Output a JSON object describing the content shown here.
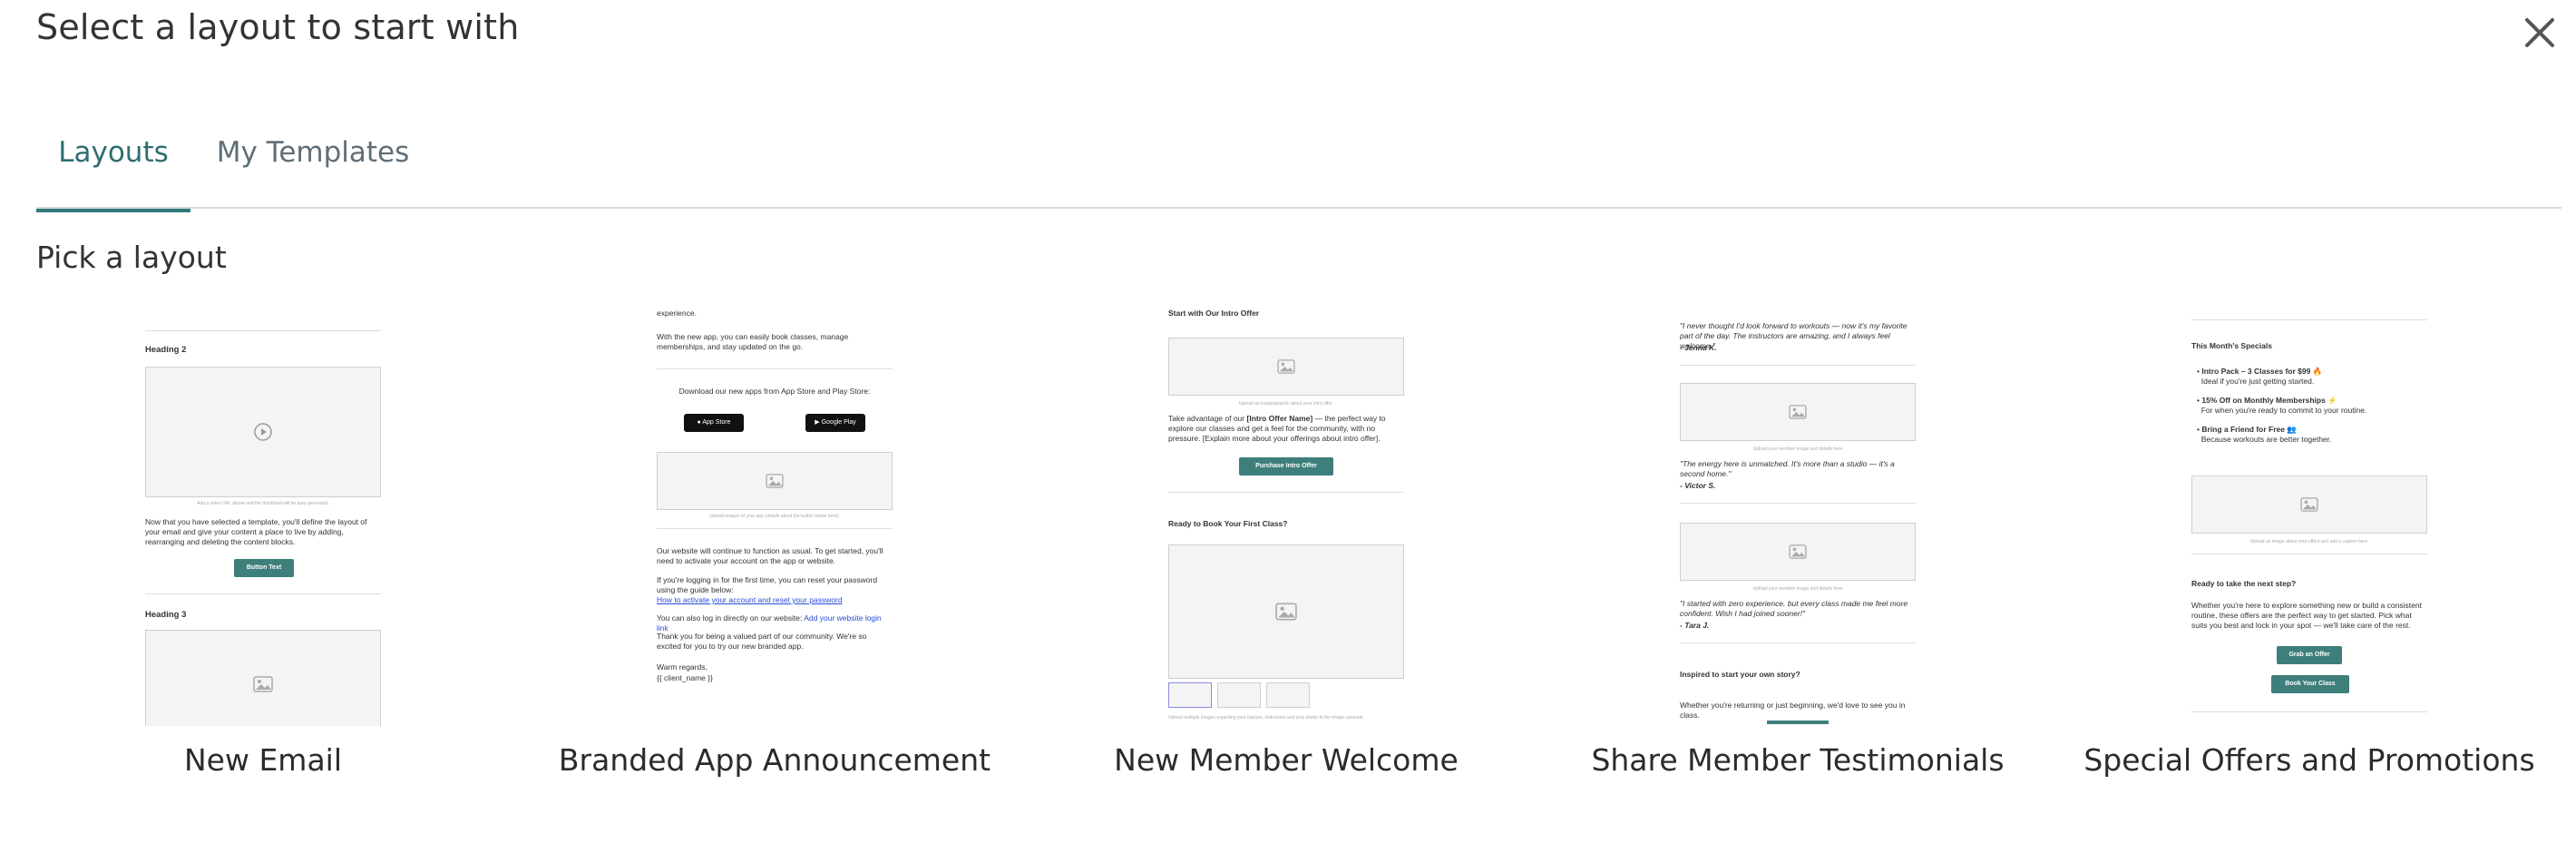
{
  "dialog": {
    "title": "Select a layout to start with",
    "close_icon": "close-icon"
  },
  "tabs": [
    {
      "label": "Layouts",
      "active": true
    },
    {
      "label": "My Templates",
      "active": false
    }
  ],
  "section_title": "Pick a layout",
  "accent_color": "#2f7a7b",
  "layouts": [
    {
      "label": "New Email",
      "preview": {
        "heading2": "Heading 2",
        "video_caption": "Add a video URL above and the thumbnail will be auto-generated.",
        "body": "Now that you have selected a template, you'll define the layout of your email and give your content a place to live by adding, rearranging and deleting the content blocks.",
        "button": "Button Text",
        "heading3": "Heading 3"
      }
    },
    {
      "label": "Branded App Announcement",
      "preview": {
        "top_line": "experience.",
        "intro": "With the new app, you can easily book classes, manage memberships, and stay updated on the go.",
        "download": "Download our new apps from App Store and Play Store:",
        "app_store": "App Store",
        "google_play": "Google Play",
        "image_caption": "Upload images of your app (details about the button below here).",
        "website": "Our website will continue to function as usual. To get started, you'll need to activate your account on the app or website.",
        "reset": "If you're logging in for the first time, you can reset your password using the guide below:",
        "reset_link": "How to activate your account and reset your password",
        "login_prefix": "You can also log in directly on our website:",
        "login_link": "Add your website login link",
        "thanks": "Thank you for being a valued part of our community. We're so excited for you to try our new branded app.",
        "regards": "Warm regards,",
        "client_name": "{{ client_name }}"
      }
    },
    {
      "label": "New Member Welcome",
      "preview": {
        "top_heading": "Start with Our Intro Offer",
        "image_caption": "Upload an image/graphic about your intro offer.",
        "offer_prefix": "Take advantage of our",
        "offer_name": "[Intro Offer Name]",
        "offer_suffix": "— the perfect way to explore our classes and get a feel for the community, with no pressure. [Explain more about your offerings about intro offer].",
        "offer_button": "Purchase Intro Offer",
        "book_heading": "Ready to Book Your First Class?",
        "gallery_caption": "Upload multiple images regarding your classes, instructors and your studio to the image carousel."
      }
    },
    {
      "label": "Share Member Testimonials",
      "preview": {
        "quote1": "\"I never thought I'd look forward to workouts — now it's my favorite part of the day. The instructors are amazing, and I always feel welcome.\"",
        "author1": "- Jenna K.",
        "caption1": "Upload your member image and details here",
        "quote2": "\"The energy here is unmatched. It's more than a studio — it's a second home.\"",
        "author2": "- Victor S.",
        "caption2": "Upload your member image and details here",
        "quote3": "\"I started with zero experience, but every class made me feel more confident. Wish I had joined sooner!\"",
        "author3": "- Tara J.",
        "heading": "Inspired to start your own story?",
        "body": "Whether you're returning or just beginning, we'd love to see you in class."
      }
    },
    {
      "label": "Special Offers and Promotions",
      "preview": {
        "heading": "This Month's Specials",
        "item1_title": "Intro Pack – 3 Classes for $99 🔥",
        "item1_desc": "Ideal if you're just getting started.",
        "item2_title": "15% Off on Monthly Memberships ⚡",
        "item2_desc": "For when you're ready to commit to your routine.",
        "item3_title": "Bring a Friend for Free 👥",
        "item3_desc": "Because workouts are better together.",
        "image_caption": "Upload an image about your offers and add a caption here.",
        "next_heading": "Ready to take the next step?",
        "next_body": "Whether you're here to explore something new or build a consistent routine, these offers are the perfect way to get started. Pick what suits you best and lock in your spot — we'll take care of the rest.",
        "button1": "Grab an Offer",
        "button2": "Book Your Class"
      }
    }
  ]
}
